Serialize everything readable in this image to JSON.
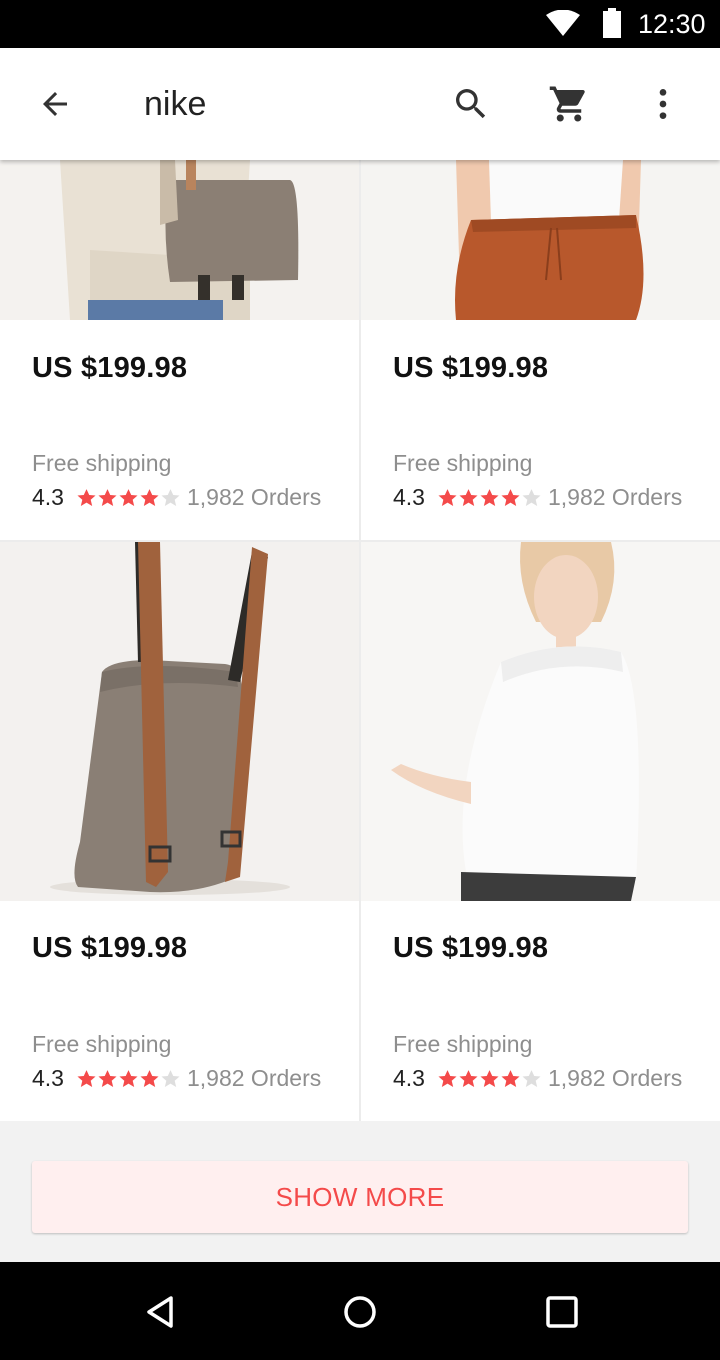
{
  "status_bar": {
    "time": "12:30",
    "icons": [
      "wifi-icon",
      "battery-icon"
    ]
  },
  "app_bar": {
    "title": "nike",
    "icons": [
      "back-arrow-icon",
      "search-icon",
      "cart-icon",
      "more-vert-icon"
    ]
  },
  "products": [
    {
      "price": "US $199.98",
      "shipping": "Free shipping",
      "rating": "4.3",
      "stars_filled": 4,
      "orders": "1,982 Orders",
      "image": "woman-with-grey-backpack"
    },
    {
      "price": "US $199.98",
      "shipping": "Free shipping",
      "rating": "4.3",
      "stars_filled": 4,
      "orders": "1,982 Orders",
      "image": "woman-in-rust-skirt"
    },
    {
      "price": "US $199.98",
      "shipping": "Free shipping",
      "rating": "4.3",
      "stars_filled": 4,
      "orders": "1,982 Orders",
      "image": "grey-canvas-backpack"
    },
    {
      "price": "US $199.98",
      "shipping": "Free shipping",
      "rating": "4.3",
      "stars_filled": 4,
      "orders": "1,982 Orders",
      "image": "woman-in-white-top"
    }
  ],
  "show_more": {
    "label": "SHOW MORE"
  },
  "nav_bar": {
    "icons": [
      "nav-back-icon",
      "nav-home-icon",
      "nav-recents-icon"
    ]
  },
  "colors": {
    "accent": "#f44a4a",
    "star_empty": "#dedede",
    "show_more_bg": "#ffefef"
  }
}
